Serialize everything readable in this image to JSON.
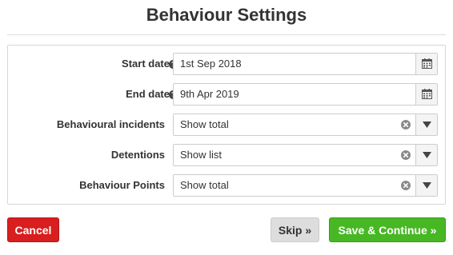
{
  "page": {
    "title": "Behaviour Settings"
  },
  "form": {
    "start_date": {
      "label": "Start date",
      "value": "1st Sep 2018",
      "help_icon": "question-circle-icon",
      "picker_icon": "calendar-icon"
    },
    "end_date": {
      "label": "End date",
      "value": "9th Apr 2019",
      "help_icon": "question-circle-icon",
      "picker_icon": "calendar-icon"
    },
    "behavioural_incidents": {
      "label": "Behavioural incidents",
      "value": "Show total"
    },
    "detentions": {
      "label": "Detentions",
      "value": "Show list"
    },
    "behaviour_points": {
      "label": "Behaviour Points",
      "value": "Show total"
    }
  },
  "actions": {
    "cancel_label": "Cancel",
    "skip_label": "Skip »",
    "save_label": "Save & Continue »"
  },
  "colors": {
    "cancel": "#d81e1e",
    "skip": "#dddddd",
    "save": "#47b824"
  }
}
